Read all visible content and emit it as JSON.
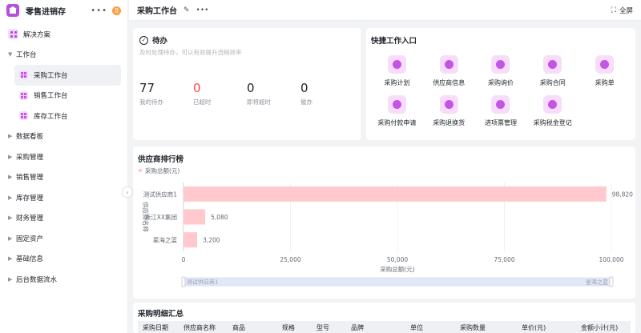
{
  "app": {
    "title": "零售进销存",
    "badge": "8"
  },
  "sidebar": {
    "solution": "解决方案",
    "groups": [
      {
        "label": "工作台",
        "expanded": true
      },
      {
        "label": "数据看板"
      },
      {
        "label": "采购管理"
      },
      {
        "label": "销售管理"
      },
      {
        "label": "库存管理"
      },
      {
        "label": "财务管理"
      },
      {
        "label": "固定资产"
      },
      {
        "label": "基础信息"
      },
      {
        "label": "后台数据流水"
      }
    ],
    "sub": [
      "采购工作台",
      "销售工作台",
      "库存工作台"
    ]
  },
  "topbar": {
    "title": "采购工作台",
    "fullscreen": "全屏"
  },
  "todo": {
    "title": "待办",
    "desc": "及时处理待办，可以有效提升流程效率",
    "stats": [
      {
        "num": "77",
        "label": "我的待办"
      },
      {
        "num": "0",
        "label": "已超时"
      },
      {
        "num": "0",
        "label": "即将超时"
      },
      {
        "num": "0",
        "label": "催办"
      }
    ]
  },
  "quick": {
    "title": "快捷工作入口",
    "items": [
      "采购计划",
      "供应商信息",
      "采购询价",
      "采购合同",
      "采购单",
      "采购付款申请",
      "采购退换货",
      "进项票管理",
      "采购税金登记"
    ]
  },
  "rank": {
    "title": "供应商排行榜"
  },
  "chart_data": {
    "type": "bar",
    "orientation": "horizontal",
    "categories": [
      "测试供应商1",
      "浙江XX集团",
      "星海之蓝"
    ],
    "series": [
      {
        "name": "采购总额(元)",
        "values": [
          98820,
          5080,
          3200
        ]
      }
    ],
    "value_labels": [
      "98,820",
      "5,080",
      "3,200"
    ],
    "xlabel": "采购总额(元)",
    "ylabel": "供应商名称",
    "xlim": [
      0,
      100000
    ],
    "xticks": [
      "0",
      "25,000",
      "50,000",
      "75,000",
      "100,000"
    ],
    "slider": {
      "start": "测试供应商1",
      "end": "星海之蓝"
    },
    "bar_color": "#ffc9ce"
  },
  "detail": {
    "title": "采购明细汇总",
    "columns": [
      "采购日期",
      "供应商名称",
      "商品",
      "规格",
      "型号",
      "品牌",
      "单位",
      "采购数量",
      "单价(元)",
      "金额小计(元)"
    ]
  },
  "colors": {
    "accent": "#b54fe0",
    "accent_light": "#f7dcfb",
    "red": "#f54a45"
  }
}
